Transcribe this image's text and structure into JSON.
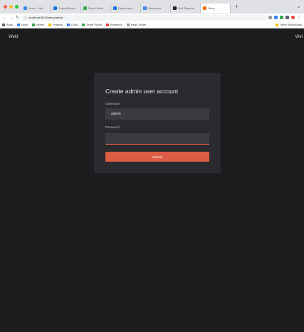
{
  "browser": {
    "tabs": [
      {
        "title": "Inbox - Mail",
        "color": "#4285f4"
      },
      {
        "title": "Project Board",
        "color": "#1a73e8"
      },
      {
        "title": "Docs Portal",
        "color": "#34a853"
      },
      {
        "title": "Dashboard",
        "color": "#1a73e8"
      },
      {
        "title": "Reference",
        "color": "#4285f4"
      },
      {
        "title": "Pull Request",
        "color": "#202124"
      },
      {
        "title": "Setup",
        "color": "#e8710a",
        "active": true
      }
    ],
    "new_tab": "+",
    "tab_menu": "⌄",
    "address": {
      "url": "localhost:3000/setup/admin"
    },
    "bookmarks": [
      {
        "label": "Apps",
        "color": "#5f6368"
      },
      {
        "label": "Work",
        "color": "#4285f4"
      },
      {
        "label": "Notes",
        "color": "#34a853"
      },
      {
        "label": "Projects",
        "color": "#fbbc04"
      },
      {
        "label": "Docs",
        "color": "#4285f4"
      },
      {
        "label": "Team Portal",
        "color": "#34a853"
      },
      {
        "label": "Research",
        "color": "#ea4335"
      },
      {
        "label": "Help Center",
        "color": "#9aa0a6"
      }
    ],
    "other_bookmarks": "Other Bookmarks"
  },
  "page": {
    "brand": "Weld",
    "corner": "Wel",
    "card": {
      "title": "Create admin user account",
      "username_label": "Username",
      "username_value": "admin",
      "password_label": "Password",
      "password_value": "",
      "submit_label": "Submit"
    }
  },
  "colors": {
    "page_bg": "#1b1c1e",
    "card_bg": "#2a2b2e",
    "field_bg": "#3a3b3e",
    "accent": "#dd5c45"
  }
}
